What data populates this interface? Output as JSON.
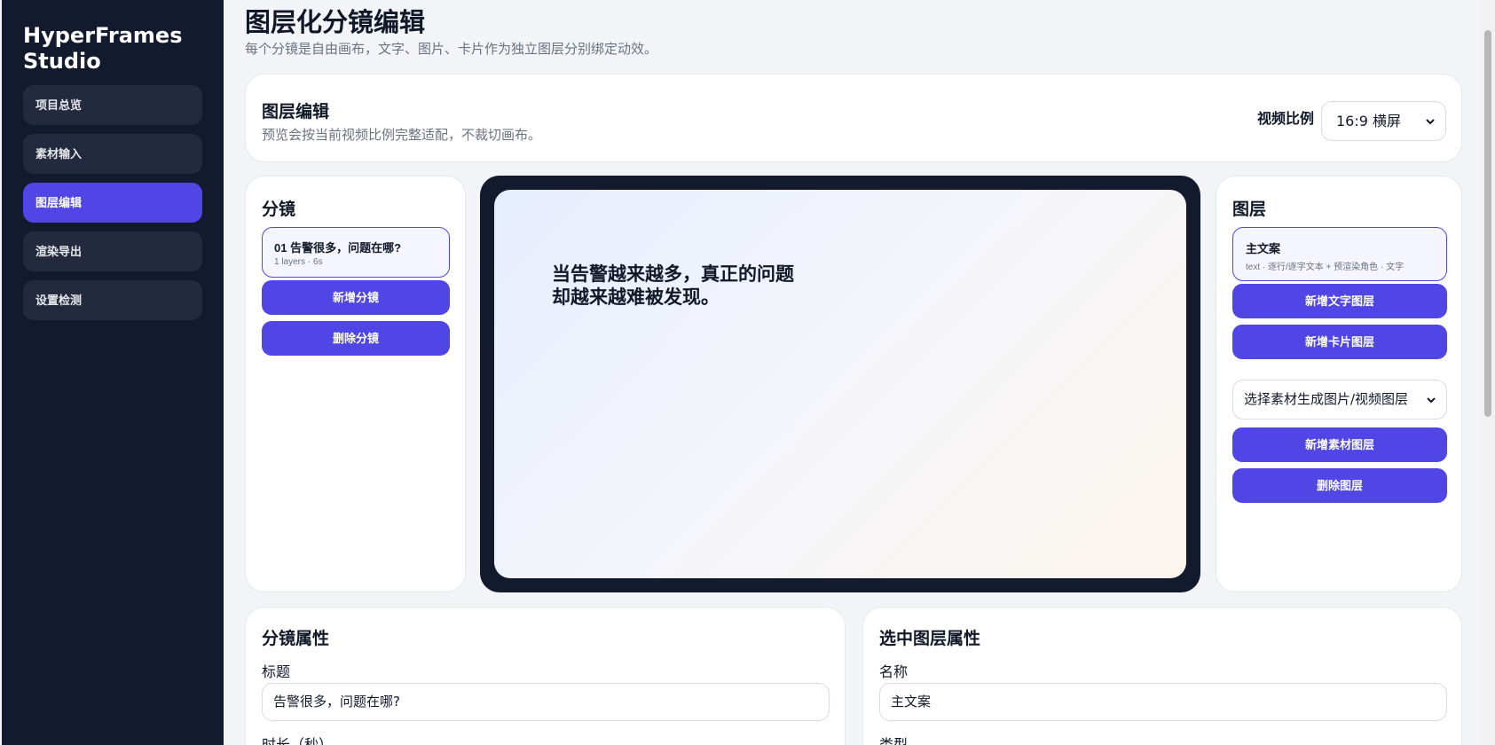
{
  "sidebar": {
    "brand": "HyperFrames Studio",
    "items": [
      {
        "label": "项目总览"
      },
      {
        "label": "素材输入"
      },
      {
        "label": "图层编辑"
      },
      {
        "label": "渲染导出"
      },
      {
        "label": "设置检测"
      }
    ],
    "active_index": 2
  },
  "header": {
    "title": "图层化分镜编辑",
    "subtitle": "每个分镜是自由画布，文字、图片、卡片作为独立图层分别绑定动效。"
  },
  "editor": {
    "title": "图层编辑",
    "subtitle": "预览会按当前视频比例完整适配，不裁切画布。",
    "ratio_label": "视频比例",
    "ratio_value": "16:9 横屏"
  },
  "scenes": {
    "title": "分镜",
    "items": [
      {
        "title": "01 告警很多，问题在哪?",
        "meta": "1 layers · 6s"
      }
    ],
    "add_label": "新增分镜",
    "delete_label": "删除分镜"
  },
  "canvas": {
    "text": "当告警越来越多，真正的问题却越来越难被发现。"
  },
  "layers": {
    "title": "图层",
    "items": [
      {
        "title": "主文案",
        "meta": "text · 逐行/逐字文本 + 预渲染角色 · 文字"
      }
    ],
    "add_text_label": "新增文字图层",
    "add_card_label": "新增卡片图层",
    "asset_select_value": "选择素材生成图片/视频图层",
    "add_asset_label": "新增素材图层",
    "delete_label": "删除图层"
  },
  "scene_props": {
    "title": "分镜属性",
    "title_label": "标题",
    "title_value": "告警很多，问题在哪?",
    "duration_label": "时长（秒）"
  },
  "layer_props": {
    "title": "选中图层属性",
    "name_label": "名称",
    "name_value": "主文案",
    "type_label": "类型"
  },
  "colors": {
    "sidebar_bg": "#131a2e",
    "accent": "#4f46e5",
    "page_bg": "#f3f4f8"
  }
}
